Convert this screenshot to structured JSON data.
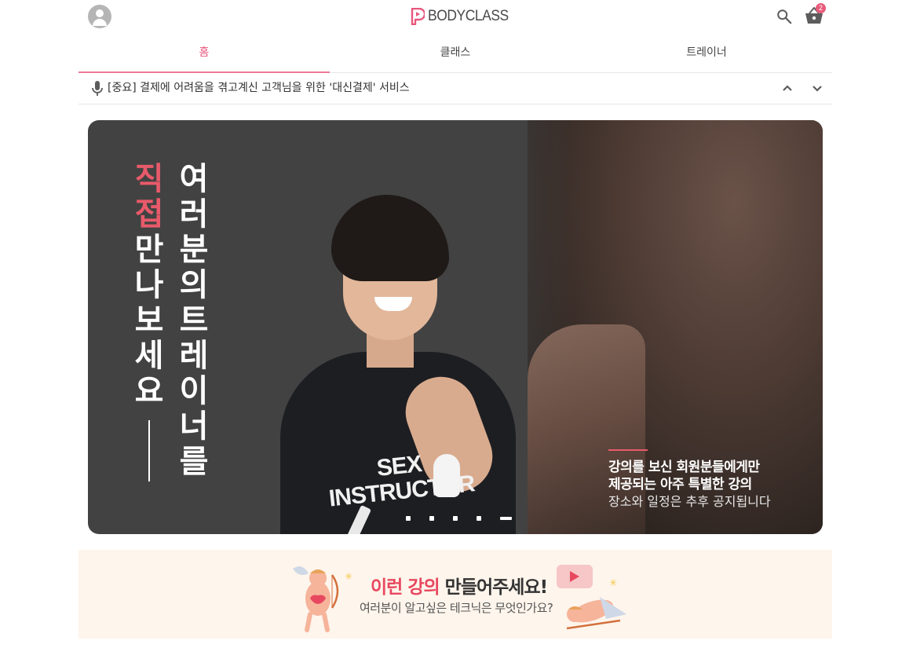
{
  "header": {
    "logo_text": "BODYCLASS",
    "cart_count": "2",
    "brand_color": "#e8577d"
  },
  "tabs": [
    {
      "label": "홈",
      "active": true
    },
    {
      "label": "클래스",
      "active": false
    },
    {
      "label": "트레이너",
      "active": false
    }
  ],
  "notice": {
    "text": "[중요] 결제에 어려움을 겪고계신 고객님을 위한 '대신결제' 서비스"
  },
  "hero": {
    "vertical_left": [
      "직",
      "접",
      "만",
      "나",
      "보",
      "세",
      "요"
    ],
    "vertical_right": [
      "여",
      "러",
      "분",
      "의",
      "트",
      "레",
      "이",
      "너",
      "를"
    ],
    "shirt_line1": "SEX",
    "shirt_line2": "INSTRUCTOR",
    "promo_line1": "강의를 보신 회원분들에게만",
    "promo_line2": "제공되는 아주 특별한 강의",
    "promo_line3": "장소와 일정은 추후 공지됩니다",
    "slide_count": 5,
    "active_slide": 5
  },
  "sub_banner": {
    "title_highlight": "이런 강의",
    "title_rest": " 만들어주세요!",
    "description": "여러분이 알고싶은 테크닉은 무엇인가요?"
  },
  "icons": {
    "profile": "user-avatar-icon",
    "search": "search-icon",
    "cart": "basket-icon",
    "notice": "microphone-icon",
    "prev": "chevron-up-icon",
    "next": "chevron-down-icon"
  }
}
